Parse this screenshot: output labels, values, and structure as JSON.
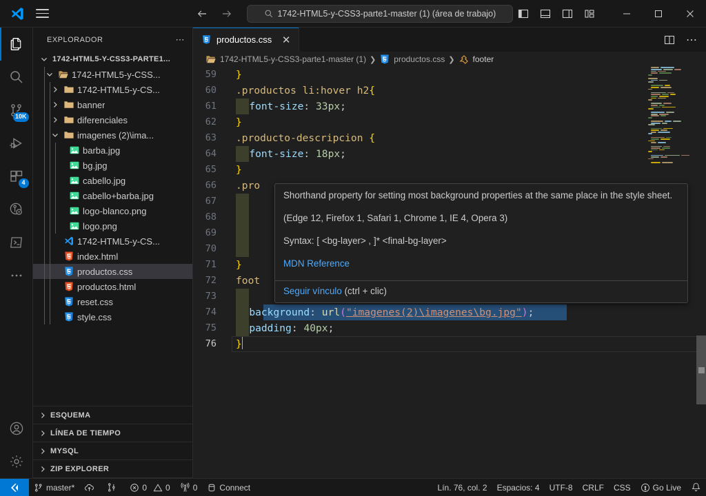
{
  "titlebar": {
    "logo_icon": "vscode-logo-icon",
    "menu_icon": "hamburger-menu-icon",
    "back_icon": "arrow-left-icon",
    "forward_icon": "arrow-right-icon",
    "search_icon": "search-icon",
    "search_text": "1742-HTML5-y-CSS3-parte1-master (1) (área de trabajo)",
    "layout": [
      {
        "name": "toggle-primary-sidebar-icon"
      },
      {
        "name": "toggle-panel-icon"
      },
      {
        "name": "toggle-secondary-sidebar-icon"
      },
      {
        "name": "customize-layout-icon"
      }
    ],
    "window": [
      {
        "name": "minimize-button",
        "glyph": "—"
      },
      {
        "name": "maximize-button",
        "glyph": "□"
      },
      {
        "name": "close-button",
        "glyph": "✕"
      }
    ]
  },
  "activitybar": {
    "items": [
      {
        "name": "explorer",
        "icon": "files-icon",
        "active": true,
        "badge": ""
      },
      {
        "name": "search",
        "icon": "search-icon",
        "active": false,
        "badge": ""
      },
      {
        "name": "source-control",
        "icon": "source-control-icon",
        "active": false,
        "badge": "10K"
      },
      {
        "name": "run-and-debug",
        "icon": "run-and-debug-icon",
        "active": false,
        "badge": ""
      },
      {
        "name": "extensions",
        "icon": "extensions-icon",
        "active": false,
        "badge": "4"
      },
      {
        "name": "remote-explorer",
        "icon": "remote-explorer-icon",
        "active": false,
        "badge": ""
      },
      {
        "name": "terminal",
        "icon": "terminal-icon",
        "active": false,
        "badge": ""
      },
      {
        "name": "more-actions",
        "icon": "ellipsis-icon",
        "active": false,
        "badge": ""
      }
    ],
    "bottom": [
      {
        "name": "accounts",
        "icon": "account-icon"
      },
      {
        "name": "manage",
        "icon": "gear-icon"
      }
    ]
  },
  "sidebar": {
    "header": "EXPLORADOR",
    "header_actions_icon": "ellipsis-icon",
    "tree": [
      {
        "label": "1742-HTML5-Y-CSS3-PARTE1...",
        "indent": 0,
        "twist": "down",
        "kind": "root",
        "selected": false
      },
      {
        "label": "1742-HTML5-y-CSS...",
        "indent": 1,
        "twist": "down",
        "kind": "folder-open",
        "selected": false
      },
      {
        "label": "1742-HTML5-y-CS...",
        "indent": 2,
        "twist": "right",
        "kind": "folder",
        "selected": false
      },
      {
        "label": "banner",
        "indent": 2,
        "twist": "right",
        "kind": "folder",
        "selected": false
      },
      {
        "label": "diferenciales",
        "indent": 2,
        "twist": "right",
        "kind": "folder",
        "selected": false
      },
      {
        "label": "imagenes (2)\\ima...",
        "indent": 2,
        "twist": "down",
        "kind": "folder",
        "selected": false
      },
      {
        "label": "barba.jpg",
        "indent": 3,
        "twist": "",
        "kind": "image",
        "selected": false
      },
      {
        "label": "bg.jpg",
        "indent": 3,
        "twist": "",
        "kind": "image",
        "selected": false
      },
      {
        "label": "cabello.jpg",
        "indent": 3,
        "twist": "",
        "kind": "image",
        "selected": false
      },
      {
        "label": "cabello+barba.jpg",
        "indent": 3,
        "twist": "",
        "kind": "image",
        "selected": false
      },
      {
        "label": "logo-blanco.png",
        "indent": 3,
        "twist": "",
        "kind": "image",
        "selected": false
      },
      {
        "label": "logo.png",
        "indent": 3,
        "twist": "",
        "kind": "image",
        "selected": false
      },
      {
        "label": "1742-HTML5-y-CS...",
        "indent": 2,
        "twist": "",
        "kind": "code-workspace",
        "selected": false
      },
      {
        "label": "index.html",
        "indent": 2,
        "twist": "",
        "kind": "html",
        "selected": false
      },
      {
        "label": "productos.css",
        "indent": 2,
        "twist": "",
        "kind": "css",
        "selected": true
      },
      {
        "label": "productos.html",
        "indent": 2,
        "twist": "",
        "kind": "html",
        "selected": false
      },
      {
        "label": "reset.css",
        "indent": 2,
        "twist": "",
        "kind": "css",
        "selected": false
      },
      {
        "label": "style.css",
        "indent": 2,
        "twist": "",
        "kind": "css",
        "selected": false
      }
    ],
    "sections": [
      {
        "label": "ESQUEMA"
      },
      {
        "label": "LÍNEA DE TIEMPO"
      },
      {
        "label": "MYSQL"
      },
      {
        "label": "ZIP EXPLORER"
      }
    ]
  },
  "editor": {
    "tab": {
      "label": "productos.css",
      "icon": "css-file-icon",
      "close_glyph": "✕"
    },
    "actions": [
      {
        "name": "split-editor-right-icon"
      },
      {
        "name": "more-editor-actions-icon"
      }
    ],
    "breadcrumb": [
      {
        "label": "1742-HTML5-y-CSS3-parte1-master (1)",
        "icon": "folder-icon"
      },
      {
        "label": "productos.css",
        "icon": "css-file-icon"
      },
      {
        "label": "footer",
        "icon": "css-symbol-icon"
      }
    ],
    "first_line": 59,
    "cursor_line": 76,
    "lines": [
      {
        "n": 59,
        "indent": 0,
        "raw": "}"
      },
      {
        "n": 60,
        "indent": 0,
        "raw": ".productos li:hover h2{"
      },
      {
        "n": 61,
        "indent": 1,
        "raw": "font-size: 33px;"
      },
      {
        "n": 62,
        "indent": 0,
        "raw": "}"
      },
      {
        "n": 63,
        "indent": 0,
        "raw": ".producto-descripcion {"
      },
      {
        "n": 64,
        "indent": 1,
        "raw": "font-size: 18px;"
      },
      {
        "n": 65,
        "indent": 0,
        "raw": "}"
      },
      {
        "n": 66,
        "indent": 0,
        "raw": ".pro"
      },
      {
        "n": 67,
        "indent": 1,
        "raw": ""
      },
      {
        "n": 68,
        "indent": 1,
        "raw": ""
      },
      {
        "n": 69,
        "indent": 1,
        "raw": ""
      },
      {
        "n": 70,
        "indent": 1,
        "raw": ""
      },
      {
        "n": 71,
        "indent": 0,
        "raw": "}"
      },
      {
        "n": 72,
        "indent": 0,
        "raw": "foot"
      },
      {
        "n": 73,
        "indent": 1,
        "raw": ""
      },
      {
        "n": 74,
        "indent": 1,
        "raw": "background: url(\"imagenes(2)\\imagenes\\bg.jpg\");"
      },
      {
        "n": 75,
        "indent": 1,
        "raw": "padding: 40px;"
      },
      {
        "n": 76,
        "indent": 0,
        "raw": "}"
      }
    ]
  },
  "hover": {
    "paragraph1": "Shorthand property for setting most background properties at the same place in the style sheet.",
    "paragraph2": "(Edge 12, Firefox 1, Safari 1, Chrome 1, IE 4, Opera 3)",
    "paragraph3": "Syntax: [ <bg-layer> , ]* <final-bg-layer>",
    "mdn_link": "MDN Reference",
    "follow_link": "Seguir vínculo",
    "follow_hint": "(ctrl + clic)"
  },
  "statusbar": {
    "remote_icon": "remote-window-icon",
    "left": [
      {
        "name": "branch",
        "icon": "source-control-icon",
        "label": "master*"
      },
      {
        "name": "sync-changes",
        "icon": "cloud-upload-icon",
        "label": ""
      },
      {
        "name": "git-graph",
        "icon": "git-graph-icon",
        "label": ""
      },
      {
        "name": "errors-warnings",
        "icon": "error-icon",
        "label": "0",
        "icon2": "warning-icon",
        "label2": "0"
      },
      {
        "name": "ports",
        "icon": "radio-tower-icon",
        "label": "0"
      },
      {
        "name": "mysql-connect",
        "icon": "database-icon",
        "label": "Connect"
      }
    ],
    "right": [
      {
        "name": "cursor-position",
        "label": "Lín. 76, col. 2"
      },
      {
        "name": "indentation",
        "label": "Espacios: 4"
      },
      {
        "name": "encoding",
        "label": "UTF-8"
      },
      {
        "name": "eol",
        "label": "CRLF"
      },
      {
        "name": "language-mode",
        "label": "CSS"
      },
      {
        "name": "go-live",
        "label": "Go Live",
        "icon": "broadcast-icon"
      },
      {
        "name": "notifications",
        "label": "",
        "icon": "bell-icon"
      }
    ]
  },
  "colors": {
    "accent": "#0078d4",
    "editor_bg": "#1f1f1f",
    "chrome_bg": "#181818",
    "selected_row": "#37373d",
    "link": "#4daafc"
  }
}
